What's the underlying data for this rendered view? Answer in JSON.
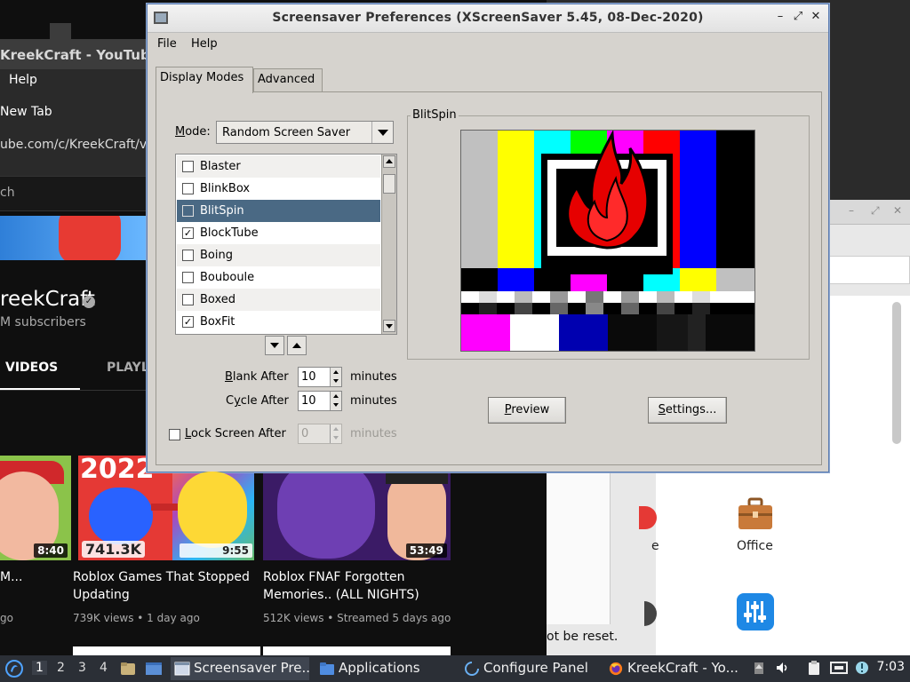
{
  "browser": {
    "window_title": "KreekCraft - YouTube",
    "menu_help": "Help",
    "menu_new_tab": "New Tab",
    "url": "ube.com/c/KreekCraft/vid",
    "search_placeholder": "ch",
    "channel_name": "reekCraft",
    "subscribers": "M subscribers",
    "tab_videos": "VIDEOS",
    "tab_playlists": "PLAYL",
    "videos": [
      {
        "duration": "8:40",
        "title": "M...",
        "meta": "go"
      },
      {
        "badge_views": "741.3K",
        "duration": "9:55",
        "title": "Roblox Games That Stopped Updating",
        "meta": "739K views • 1 day ago",
        "year_text": "2022"
      },
      {
        "duration": "53:49",
        "title": "Roblox FNAF Forgotten Memories.. (ALL NIGHTS)",
        "meta": "512K views • Streamed 5 days ago"
      }
    ]
  },
  "panel": {
    "office_label": "Office",
    "partial_label": "e",
    "reset_text": "ot be reset."
  },
  "xss": {
    "title": "Screensaver Preferences  (XScreenSaver 5.45, 08-Dec-2020)",
    "window_buttons": {
      "minimize": "–",
      "maximize": "⤢",
      "close": "✕"
    },
    "menu": {
      "file": "File",
      "help": "Help"
    },
    "tabs": {
      "display_modes": "Display Modes",
      "advanced": "Advanced"
    },
    "mode_label": "ode:",
    "mode_label_m": "M",
    "mode_value": "Random Screen Saver",
    "savers": [
      {
        "name": "Blaster",
        "checked": false,
        "selected": false
      },
      {
        "name": "BlinkBox",
        "checked": false,
        "selected": false
      },
      {
        "name": "BlitSpin",
        "checked": false,
        "selected": true
      },
      {
        "name": "BlockTube",
        "checked": true,
        "selected": false
      },
      {
        "name": "Boing",
        "checked": false,
        "selected": false
      },
      {
        "name": "Bouboule",
        "checked": false,
        "selected": false
      },
      {
        "name": "Boxed",
        "checked": false,
        "selected": false
      },
      {
        "name": "BoxFit",
        "checked": true,
        "selected": false
      }
    ],
    "blank_after_b": "B",
    "blank_after_rest": "lank After",
    "blank_after_value": "10",
    "cycle_after_pre": "C",
    "cycle_after_y": "y",
    "cycle_after_rest": "cle After",
    "cycle_after_value": "10",
    "minutes": "minutes",
    "lock_l": "L",
    "lock_rest": "ock Screen After",
    "lock_value": "0",
    "preview_frame_title": "BlitSpin",
    "preview_button_p": "P",
    "preview_button_rest": "review",
    "settings_button_s": "S",
    "settings_button_rest": "ettings...",
    "colors": {
      "selection": "#4a6984",
      "window_bg": "#d6d3ce"
    }
  },
  "taskbar": {
    "workspaces": [
      "1",
      "2",
      "3",
      "4"
    ],
    "tasks": [
      {
        "label": "Screensaver Pre...",
        "icon": "window-icon"
      },
      {
        "label": "Applications",
        "icon": "folder-icon"
      },
      {
        "label": "Configure Panel",
        "icon": "configure-icon"
      },
      {
        "label": "KreekCraft - Yo...",
        "icon": "firefox-icon"
      }
    ],
    "clock": "7:03"
  }
}
